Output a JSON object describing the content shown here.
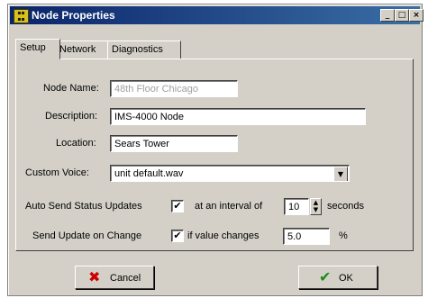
{
  "window": {
    "title": "Node Properties",
    "controls": [
      "_",
      "□",
      "×"
    ]
  },
  "tabs": [
    "Setup",
    "Network",
    "Diagnostics"
  ],
  "form": {
    "node_name_label": "Node Name:",
    "node_name_value": "48th Floor Chicago",
    "description_label": "Description:",
    "description_value": "IMS-4000 Node",
    "location_label": "Location:",
    "location_value": "Sears Tower",
    "custom_voice_label": "Custom Voice:",
    "custom_voice_value": "unit default.wav",
    "auto_send_label": "Auto Send Status Updates",
    "auto_send_checked": true,
    "interval_label": "at an interval of",
    "interval_value": "10",
    "seconds_label": "seconds",
    "send_on_change_label": "Send Update on Change",
    "send_on_change_checked": true,
    "if_changes_label": "if value changes",
    "change_value": "5.0",
    "percent_label": "%"
  },
  "buttons": {
    "cancel": "Cancel",
    "ok": "OK"
  },
  "colors": {
    "titlebar": "#0a246a",
    "face": "#d4d0c8",
    "cancel_icon": "#cc0000",
    "ok_icon": "#1a8a1a"
  },
  "icons": {
    "check_mark": "✔",
    "cancel_mark": "✖",
    "dropdown": "▼",
    "spin_up": "▲",
    "spin_down": "▼"
  }
}
